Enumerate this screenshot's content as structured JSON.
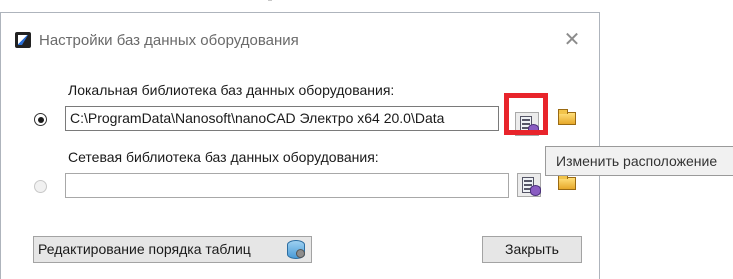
{
  "dialog": {
    "title": "Настройки баз данных оборудования",
    "close_symbol": "✕"
  },
  "local": {
    "label": "Локальная библиотека баз данных оборудования:",
    "path": "C:\\ProgramData\\Nanosoft\\nanoCAD Электро x64 20.0\\Data",
    "selected": true,
    "buttons": [
      "database-edit-icon",
      "folder-open-icon"
    ]
  },
  "network": {
    "label": "Сетевая библиотека баз данных оборудования:",
    "path": "",
    "selected": false,
    "buttons": [
      "database-edit-icon",
      "folder-open-icon"
    ]
  },
  "tooltip": {
    "text": "Изменить расположение"
  },
  "footer": {
    "edit_tables_label": "Редактирование порядка таблиц",
    "close_label": "Закрыть"
  },
  "colors": {
    "highlight": "#e8242b",
    "accent": "#2b6fd6"
  }
}
